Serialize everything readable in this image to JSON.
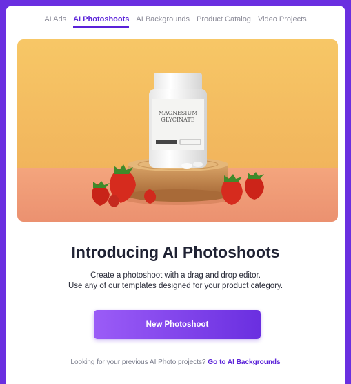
{
  "tabs": [
    {
      "label": "AI Ads",
      "active": false
    },
    {
      "label": "AI Photoshoots",
      "active": true
    },
    {
      "label": "AI Backgrounds",
      "active": false
    },
    {
      "label": "Product Catalog",
      "active": false
    },
    {
      "label": "Video Projects",
      "active": false
    }
  ],
  "hero": {
    "bottle_label_top": "MAGNESIUM",
    "bottle_label_bottom": "GLYCINATE"
  },
  "main": {
    "title": "Introducing AI Photoshoots",
    "desc_line1": "Create a photoshoot with a drag and drop editor.",
    "desc_line2": "Use any of our templates designed for your product category.",
    "cta_label": "New Photoshoot"
  },
  "footer": {
    "text": "Looking for your previous AI Photo projects?",
    "link": "Go to AI Backgrounds"
  },
  "colors": {
    "accent": "#5a22d8",
    "frame": "#6a2fe0"
  }
}
